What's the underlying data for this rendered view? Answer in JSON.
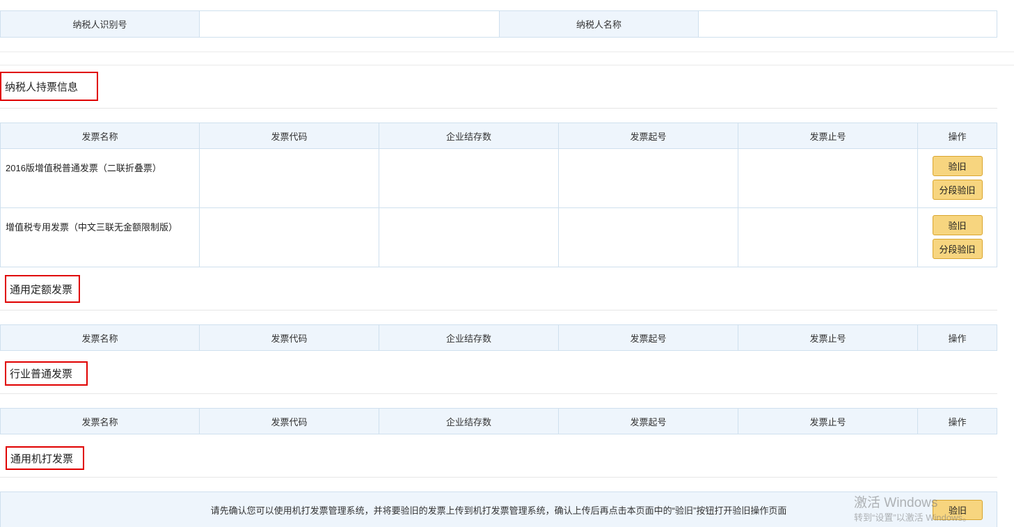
{
  "taxpayer": {
    "id_label": "纳税人识别号",
    "id_value": "",
    "name_label": "纳税人名称",
    "name_value": ""
  },
  "columns": [
    "发票名称",
    "发票代码",
    "企业结存数",
    "发票起号",
    "发票止号",
    "操作"
  ],
  "sections": {
    "held": {
      "title": "纳税人持票信息",
      "rows": [
        {
          "name": "2016版增值税普通发票（二联折叠票）",
          "code": "",
          "stock": "",
          "start": "",
          "end": ""
        },
        {
          "name": "增值税专用发票（中文三联无金额限制版）",
          "code": "",
          "stock": "",
          "start": "",
          "end": ""
        }
      ]
    },
    "quota": {
      "title": "通用定额发票"
    },
    "industry": {
      "title": "行业普通发票"
    },
    "machine": {
      "title": "通用机打发票"
    }
  },
  "buttons": {
    "verify": "验旧",
    "segment_verify": "分段验旧"
  },
  "notice": {
    "text": "请先确认您可以使用机打发票管理系统，并将要验旧的发票上传到机打发票管理系统，确认上传后再点击本页面中的“验旧”按钮打开验旧操作页面"
  },
  "watermark": {
    "line1": "激活 Windows",
    "line2": "转到“设置”以激活 Windows。"
  }
}
